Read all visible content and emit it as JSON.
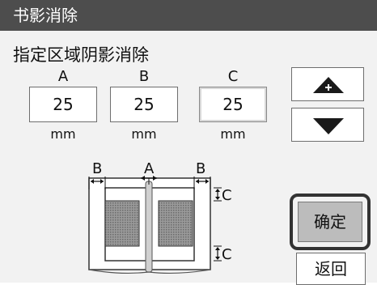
{
  "window": {
    "title": "书影消除"
  },
  "heading": "指定区域阴影消除",
  "columns": [
    {
      "label": "A",
      "value": "25",
      "unit": "mm"
    },
    {
      "label": "B",
      "value": "25",
      "unit": "mm"
    },
    {
      "label": "C",
      "value": "25",
      "unit": "mm"
    }
  ],
  "diagram": {
    "label_a": "A",
    "label_b": "B",
    "label_c": "C"
  },
  "buttons": {
    "ok": "确定",
    "back": "返回"
  },
  "icons": {
    "up": "up-plus-arrow-icon",
    "down": "down-arrow-icon"
  }
}
